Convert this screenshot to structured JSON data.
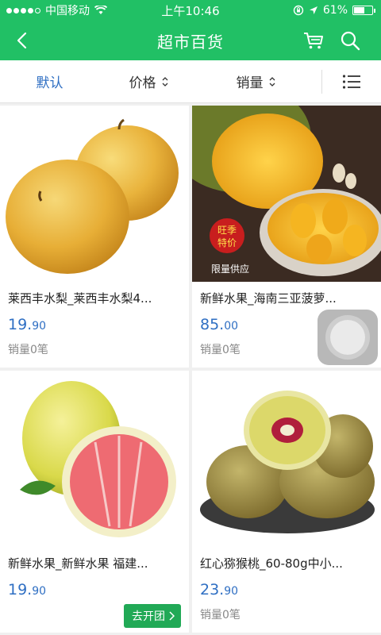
{
  "status": {
    "carrier": "中国移动",
    "time": "上午10:46",
    "battery_text": "61%",
    "battery_level": 0.61
  },
  "header": {
    "title": "超市百货"
  },
  "sortbar": {
    "default_label": "默认",
    "price_label": "价格",
    "sales_label": "销量"
  },
  "products": [
    {
      "title": "莱西丰水梨_莱西丰水梨4...",
      "price_int": "19.",
      "price_dec": "90",
      "sales": "销量0笔",
      "image": "pears"
    },
    {
      "title": "新鲜水果_海南三亚菠萝...",
      "price_int": "85.",
      "price_dec": "00",
      "sales": "销量0笔",
      "image": "jackfruit",
      "badge_top": "旺季",
      "badge_bottom": "特价",
      "banner": "限量供应"
    },
    {
      "title": "新鲜水果_新鲜水果 福建...",
      "price_int": "19.",
      "price_dec": "90",
      "sales": "",
      "image": "pomelo",
      "group_button": "去开团"
    },
    {
      "title": "红心猕猴桃_60-80g中小...",
      "price_int": "23.",
      "price_dec": "90",
      "sales": "销量0笔",
      "image": "kiwi"
    }
  ],
  "colors": {
    "brand_green": "#21c065",
    "price_blue": "#2f6fc3",
    "button_green": "#21a956"
  }
}
